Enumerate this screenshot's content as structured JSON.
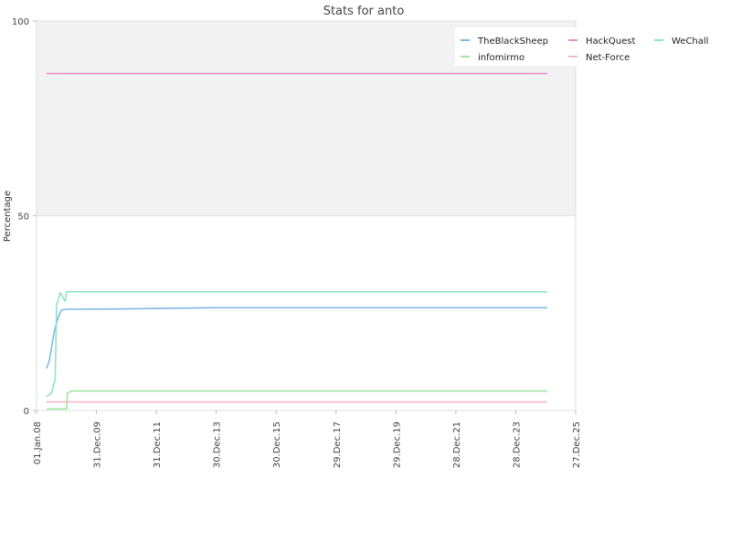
{
  "chart_data": {
    "type": "line",
    "title": "Stats for anto",
    "xlabel": "",
    "ylabel": "Percentage",
    "ylim": [
      0,
      100
    ],
    "xlim": [
      "2008-01-01",
      "2025-12-27"
    ],
    "y_ticks": [
      0,
      50,
      100
    ],
    "x_ticks": [
      {
        "date": "2008-01-01",
        "label": "01.Jan.08"
      },
      {
        "date": "2009-12-31",
        "label": "31.Dec.09"
      },
      {
        "date": "2011-12-31",
        "label": "31.Dec.11"
      },
      {
        "date": "2013-12-30",
        "label": "30.Dec.13"
      },
      {
        "date": "2015-12-30",
        "label": "30.Dec.15"
      },
      {
        "date": "2017-12-29",
        "label": "29.Dec.17"
      },
      {
        "date": "2019-12-29",
        "label": "29.Dec.19"
      },
      {
        "date": "2021-12-28",
        "label": "28.Dec.21"
      },
      {
        "date": "2023-12-28",
        "label": "28.Dec.23"
      },
      {
        "date": "2025-12-27",
        "label": "27.Dec.25"
      }
    ],
    "shaded_band": {
      "from": 50,
      "to": 100,
      "color": "#f2f2f2"
    },
    "grid": true,
    "legend_position": "top-right",
    "series": [
      {
        "name": "TheBlackSheep",
        "color": "#7fbbe6",
        "points": [
          [
            "2008-05-01",
            10.8
          ],
          [
            "2008-06-01",
            12.5
          ],
          [
            "2008-07-01",
            16
          ],
          [
            "2008-08-01",
            20
          ],
          [
            "2008-09-01",
            22.5
          ],
          [
            "2008-10-01",
            24.5
          ],
          [
            "2008-11-01",
            25.8
          ],
          [
            "2009-01-01",
            26
          ],
          [
            "2011-01-01",
            26.1
          ],
          [
            "2013-12-01",
            26.4
          ],
          [
            "2025-01-15",
            26.4
          ]
        ]
      },
      {
        "name": "infomirmo",
        "color": "#9ee69e",
        "points": [
          [
            "2008-05-01",
            0.4
          ],
          [
            "2009-01-01",
            0.4
          ],
          [
            "2009-01-10",
            4.5
          ],
          [
            "2009-03-01",
            5
          ],
          [
            "2025-01-15",
            5
          ]
        ]
      },
      {
        "name": "HackQuest",
        "color": "#e88fc4",
        "points": [
          [
            "2008-05-01",
            86.5
          ],
          [
            "2025-01-15",
            86.5
          ]
        ]
      },
      {
        "name": "Net-Force",
        "color": "#f4b6c8",
        "points": [
          [
            "2008-05-01",
            2.2
          ],
          [
            "2025-01-15",
            2.2
          ]
        ]
      },
      {
        "name": "WeChall",
        "color": "#8fe3c8",
        "points": [
          [
            "2008-05-01",
            3.5
          ],
          [
            "2008-07-01",
            4.5
          ],
          [
            "2008-08-15",
            8
          ],
          [
            "2008-09-01",
            27
          ],
          [
            "2008-10-15",
            30.2
          ],
          [
            "2008-12-15",
            28
          ],
          [
            "2009-01-01",
            30.5
          ],
          [
            "2025-01-15",
            30.5
          ]
        ]
      }
    ],
    "legend_order": [
      "TheBlackSheep",
      "HackQuest",
      "WeChall",
      "infomirmo",
      "Net-Force"
    ]
  }
}
